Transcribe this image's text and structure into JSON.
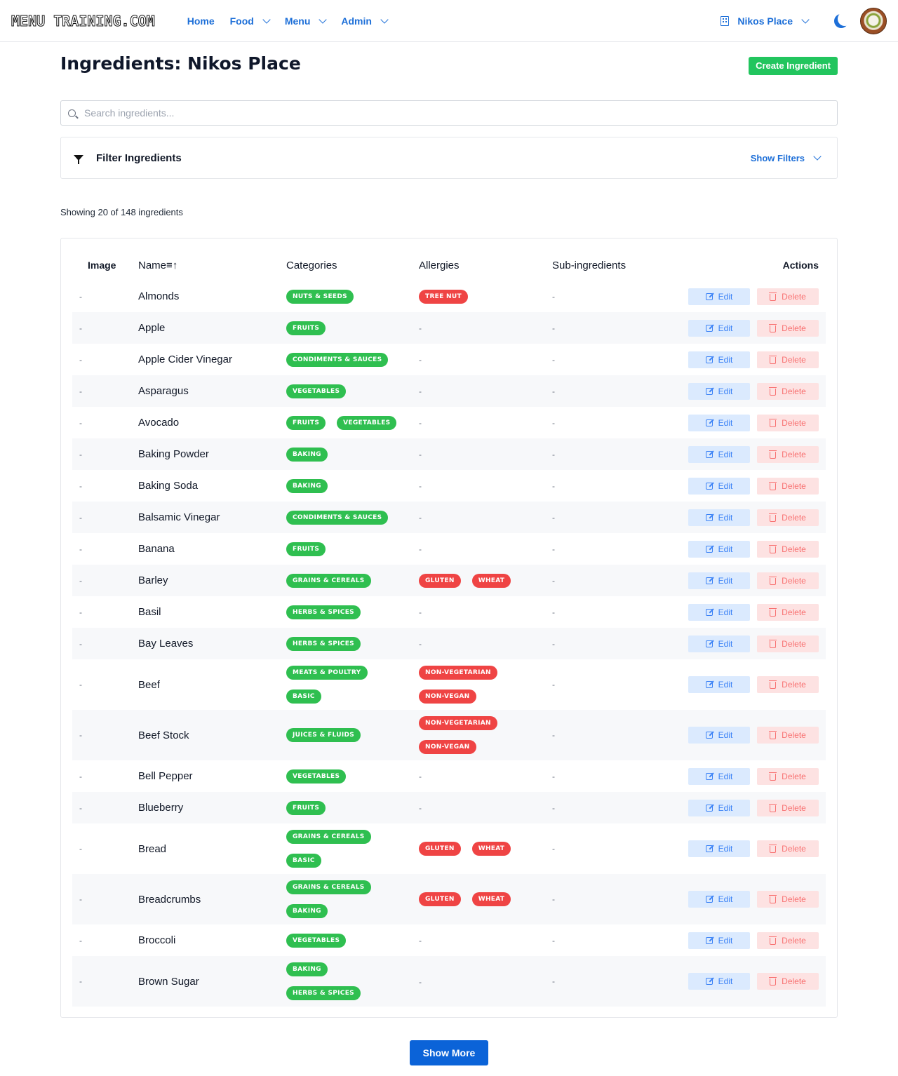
{
  "nav": {
    "logo": "MENU TRAINING.COM",
    "links": [
      {
        "label": "Home",
        "dropdown": false
      },
      {
        "label": "Food",
        "dropdown": true
      },
      {
        "label": "Menu",
        "dropdown": true
      },
      {
        "label": "Admin",
        "dropdown": true
      }
    ],
    "place": "Nikos Place"
  },
  "page": {
    "title": "Ingredients: Nikos Place",
    "create_label": "Create Ingredient",
    "search_placeholder": "Search ingredients...",
    "filter_label": "Filter Ingredients",
    "show_filters_label": "Show Filters",
    "count_text": "Showing 20 of 148 ingredients",
    "show_more_label": "Show More"
  },
  "table": {
    "headers": {
      "image": "Image",
      "name": "Name≡↑",
      "categories": "Categories",
      "allergies": "Allergies",
      "sub": "Sub-ingredients",
      "actions": "Actions"
    },
    "edit_label": "Edit",
    "delete_label": "Delete",
    "empty": "-",
    "rows": [
      {
        "name": "Almonds",
        "categories": [
          "NUTS & SEEDS"
        ],
        "allergies": [
          "TREE NUT"
        ]
      },
      {
        "name": "Apple",
        "categories": [
          "FRUITS"
        ],
        "allergies": []
      },
      {
        "name": "Apple Cider Vinegar",
        "categories": [
          "CONDIMENTS & SAUCES"
        ],
        "allergies": []
      },
      {
        "name": "Asparagus",
        "categories": [
          "VEGETABLES"
        ],
        "allergies": []
      },
      {
        "name": "Avocado",
        "categories": [
          "FRUITS",
          "VEGETABLES"
        ],
        "allergies": []
      },
      {
        "name": "Baking Powder",
        "categories": [
          "BAKING"
        ],
        "allergies": []
      },
      {
        "name": "Baking Soda",
        "categories": [
          "BAKING"
        ],
        "allergies": []
      },
      {
        "name": "Balsamic Vinegar",
        "categories": [
          "CONDIMENTS & SAUCES"
        ],
        "allergies": []
      },
      {
        "name": "Banana",
        "categories": [
          "FRUITS"
        ],
        "allergies": []
      },
      {
        "name": "Barley",
        "categories": [
          "GRAINS & CEREALS"
        ],
        "allergies": [
          "GLUTEN",
          "WHEAT"
        ]
      },
      {
        "name": "Basil",
        "categories": [
          "HERBS & SPICES"
        ],
        "allergies": []
      },
      {
        "name": "Bay Leaves",
        "categories": [
          "HERBS & SPICES"
        ],
        "allergies": []
      },
      {
        "name": "Beef",
        "categories": [
          "MEATS & POULTRY",
          "BASIC"
        ],
        "allergies": [
          "NON-VEGETARIAN",
          "NON-VEGAN"
        ]
      },
      {
        "name": "Beef Stock",
        "categories": [
          "JUICES & FLUIDS"
        ],
        "allergies": [
          "NON-VEGETARIAN",
          "NON-VEGAN"
        ]
      },
      {
        "name": "Bell Pepper",
        "categories": [
          "VEGETABLES"
        ],
        "allergies": []
      },
      {
        "name": "Blueberry",
        "categories": [
          "FRUITS"
        ],
        "allergies": []
      },
      {
        "name": "Bread",
        "categories": [
          "GRAINS & CEREALS",
          "BASIC"
        ],
        "allergies": [
          "GLUTEN",
          "WHEAT"
        ]
      },
      {
        "name": "Breadcrumbs",
        "categories": [
          "GRAINS & CEREALS",
          "BAKING"
        ],
        "allergies": [
          "GLUTEN",
          "WHEAT"
        ]
      },
      {
        "name": "Broccoli",
        "categories": [
          "VEGETABLES"
        ],
        "allergies": []
      },
      {
        "name": "Brown Sugar",
        "categories": [
          "BAKING",
          "HERBS & SPICES"
        ],
        "allergies": []
      }
    ]
  },
  "colors": {
    "accent": "#1d6fd8",
    "category_badge": "#2fbf50",
    "allergy_badge": "#ef4444",
    "create_button": "#22c55e"
  }
}
